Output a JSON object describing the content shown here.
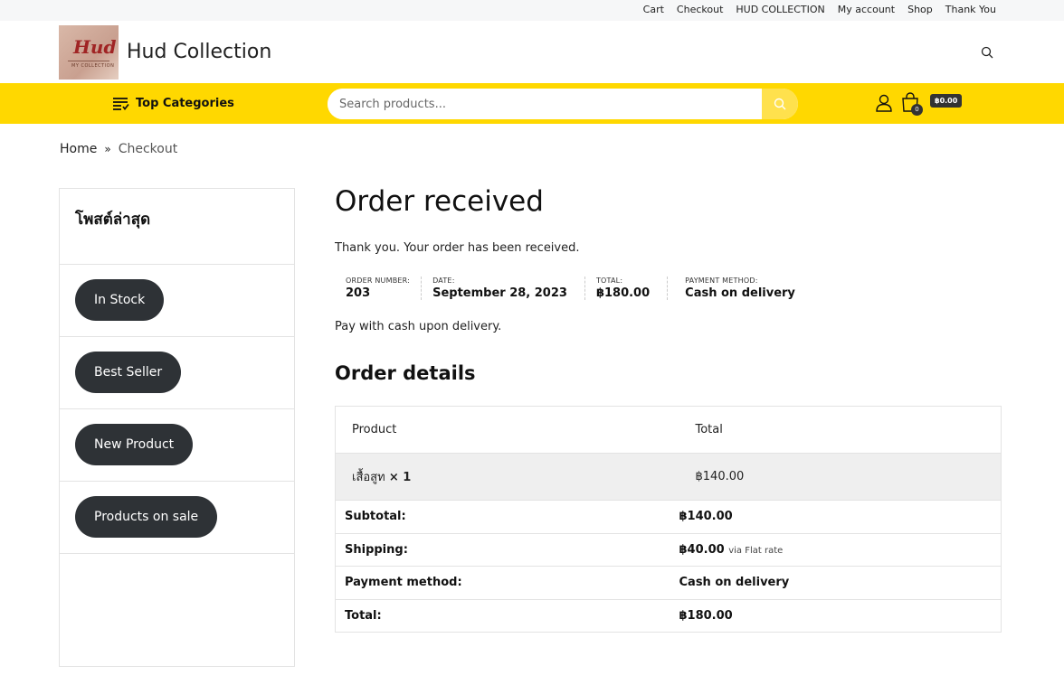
{
  "topbar": {
    "links": [
      "Cart",
      "Checkout",
      "HUD COLLECTION",
      "My account",
      "Shop",
      "Thank You"
    ]
  },
  "header": {
    "logo_text": "Hud",
    "logo_subtext": "MY COLLECTION",
    "site_name": "Hud Collection",
    "search_icon": "search-icon"
  },
  "navbar": {
    "categories_label": "Top Categories",
    "search_placeholder": "Search products...",
    "cart_count": "0",
    "cart_amount": "฿0.00",
    "accent_color": "#ffd800"
  },
  "breadcrumb": {
    "home": "Home",
    "separator": "»",
    "current": "Checkout"
  },
  "sidebar": {
    "title": "โพสต์ล่าสุด",
    "items": [
      "In Stock",
      "Best Seller",
      "New Product",
      "Products on sale"
    ]
  },
  "main": {
    "title": "Order received",
    "thanks": "Thank you. Your order has been received.",
    "overview": [
      {
        "label": "ORDER NUMBER:",
        "value": "203"
      },
      {
        "label": "DATE:",
        "value": "September 28, 2023"
      },
      {
        "label": "TOTAL:",
        "value": "฿180.00"
      },
      {
        "label": "PAYMENT METHOD:",
        "value": "Cash on delivery"
      }
    ],
    "pay_note": "Pay with cash upon delivery.",
    "details_title": "Order details",
    "table": {
      "col_product": "Product",
      "col_total": "Total",
      "item_name": "เสื้อสูท",
      "item_qty": "× 1",
      "item_total": "฿140.00",
      "subtotal_label": "Subtotal:",
      "subtotal_value": "฿140.00",
      "shipping_label": "Shipping:",
      "shipping_value": "฿40.00",
      "shipping_via": "via Flat rate",
      "payment_label": "Payment method:",
      "payment_value": "Cash on delivery",
      "total_label": "Total:",
      "total_value": "฿180.00"
    }
  }
}
